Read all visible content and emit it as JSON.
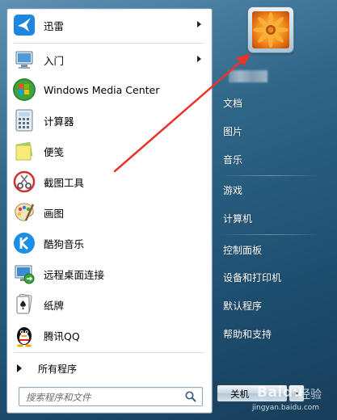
{
  "pinned": [
    {
      "label": "迅雷",
      "icon": "xunlei-bird-icon",
      "has_submenu": true
    }
  ],
  "programs": [
    {
      "label": "入门",
      "icon": "getting-started-icon",
      "has_submenu": true
    },
    {
      "label": "Windows Media Center",
      "icon": "windows-logo-icon",
      "has_submenu": false
    },
    {
      "label": "计算器",
      "icon": "calculator-icon",
      "has_submenu": false
    },
    {
      "label": "便笺",
      "icon": "sticky-notes-icon",
      "has_submenu": false
    },
    {
      "label": "截图工具",
      "icon": "snipping-tool-icon",
      "has_submenu": false
    },
    {
      "label": "画图",
      "icon": "paint-palette-icon",
      "has_submenu": false
    },
    {
      "label": "酷狗音乐",
      "icon": "kugou-icon",
      "has_submenu": false
    },
    {
      "label": "远程桌面连接",
      "icon": "remote-desktop-icon",
      "has_submenu": false
    },
    {
      "label": "纸牌",
      "icon": "solitaire-cards-icon",
      "has_submenu": false
    },
    {
      "label": "腾讯QQ",
      "icon": "qq-penguin-icon",
      "has_submenu": false
    }
  ],
  "all_programs_label": "所有程序",
  "search": {
    "placeholder": "搜索程序和文件"
  },
  "right_links_group1": [
    "文档",
    "图片",
    "音乐"
  ],
  "right_links_group2": [
    "游戏",
    "计算机"
  ],
  "right_links_group3": [
    "控制面板",
    "设备和打印机",
    "默认程序",
    "帮助和支持"
  ],
  "shutdown_label": "关机",
  "watermark": {
    "brand": "Baidu",
    "cn": "经验",
    "url": "jingyan.baidu.com"
  },
  "colors": {
    "annotation_arrow": "#e8342c",
    "menu_background": "#2f6688"
  }
}
